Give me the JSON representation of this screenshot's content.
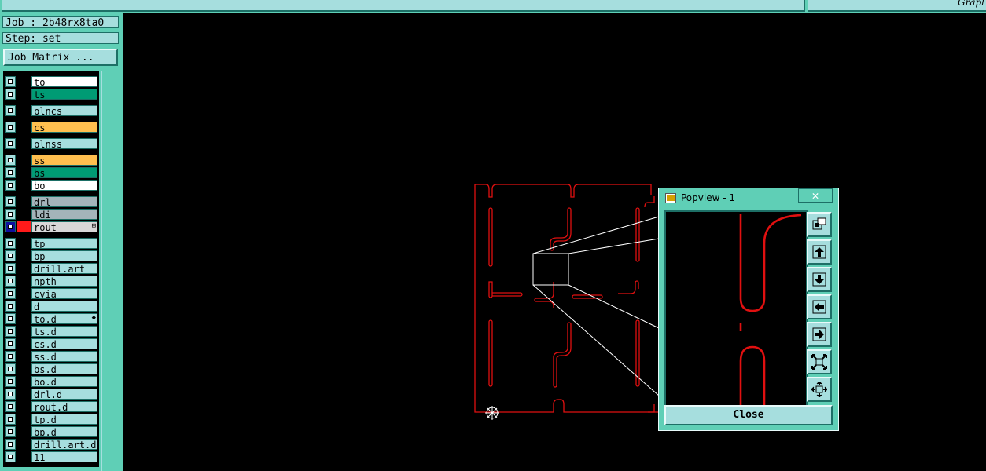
{
  "header": {
    "right_label": "Grapl"
  },
  "job": {
    "label": "Job : 2b48rx8ta0"
  },
  "step": {
    "label": "Step: set"
  },
  "job_matrix_button": "Job Matrix ...",
  "layers": [
    {
      "name": "to",
      "bg": "#ffffff",
      "group": 0
    },
    {
      "name": "ts",
      "bg": "#009b74",
      "group": 0
    },
    {
      "name": "plncs",
      "bg": "#a6dede",
      "group": 1
    },
    {
      "name": "cs",
      "bg": "#ffbf4f",
      "group": 2
    },
    {
      "name": "plnss",
      "bg": "#a6dede",
      "group": 3
    },
    {
      "name": "ss",
      "bg": "#ffbf4f",
      "group": 4
    },
    {
      "name": "bs",
      "bg": "#009b74",
      "group": 4
    },
    {
      "name": "bo",
      "bg": "#ffffff",
      "group": 4
    },
    {
      "name": "drl",
      "bg": "#a4b4ba",
      "group": 5
    },
    {
      "name": "ldi",
      "bg": "#a4b4ba",
      "group": 5
    },
    {
      "name": "rout",
      "bg": "#d8d8d8",
      "group": 5,
      "selected": true,
      "color": "#ff1a1a",
      "mark": "⊞"
    },
    {
      "name": "tp",
      "bg": "#a6dede",
      "group": 6
    },
    {
      "name": "bp",
      "bg": "#a6dede",
      "group": 6
    },
    {
      "name": "drill.art",
      "bg": "#a6dede",
      "group": 6
    },
    {
      "name": "npth",
      "bg": "#a6dede",
      "group": 6
    },
    {
      "name": "cvia",
      "bg": "#a6dede",
      "group": 6
    },
    {
      "name": "d",
      "bg": "#a6dede",
      "group": 6
    },
    {
      "name": "to.d",
      "bg": "#a6dede",
      "group": 6,
      "mark": "◆"
    },
    {
      "name": "ts.d",
      "bg": "#a6dede",
      "group": 6
    },
    {
      "name": "cs.d",
      "bg": "#a6dede",
      "group": 6
    },
    {
      "name": "ss.d",
      "bg": "#a6dede",
      "group": 6
    },
    {
      "name": "bs.d",
      "bg": "#a6dede",
      "group": 6
    },
    {
      "name": "bo.d",
      "bg": "#a6dede",
      "group": 6
    },
    {
      "name": "drl.d",
      "bg": "#a6dede",
      "group": 6
    },
    {
      "name": "rout.d",
      "bg": "#a6dede",
      "group": 6
    },
    {
      "name": "tp.d",
      "bg": "#a6dede",
      "group": 6
    },
    {
      "name": "bp.d",
      "bg": "#a6dede",
      "group": 6
    },
    {
      "name": "drill.art.d",
      "bg": "#a6dede",
      "group": 6
    },
    {
      "name": "11",
      "bg": "#a6dede",
      "group": 6
    }
  ],
  "popview": {
    "title": "Popview - 1",
    "close_x": "✕",
    "close_button": "Close",
    "tools": [
      "zoom-window-icon",
      "move-up-icon",
      "move-down-icon",
      "move-left-icon",
      "move-right-icon",
      "zoom-out-icon",
      "zoom-in-icon"
    ]
  },
  "colors": {
    "route_line": "#e01010",
    "panel": "#5fcfb6",
    "button": "#a6dede"
  }
}
